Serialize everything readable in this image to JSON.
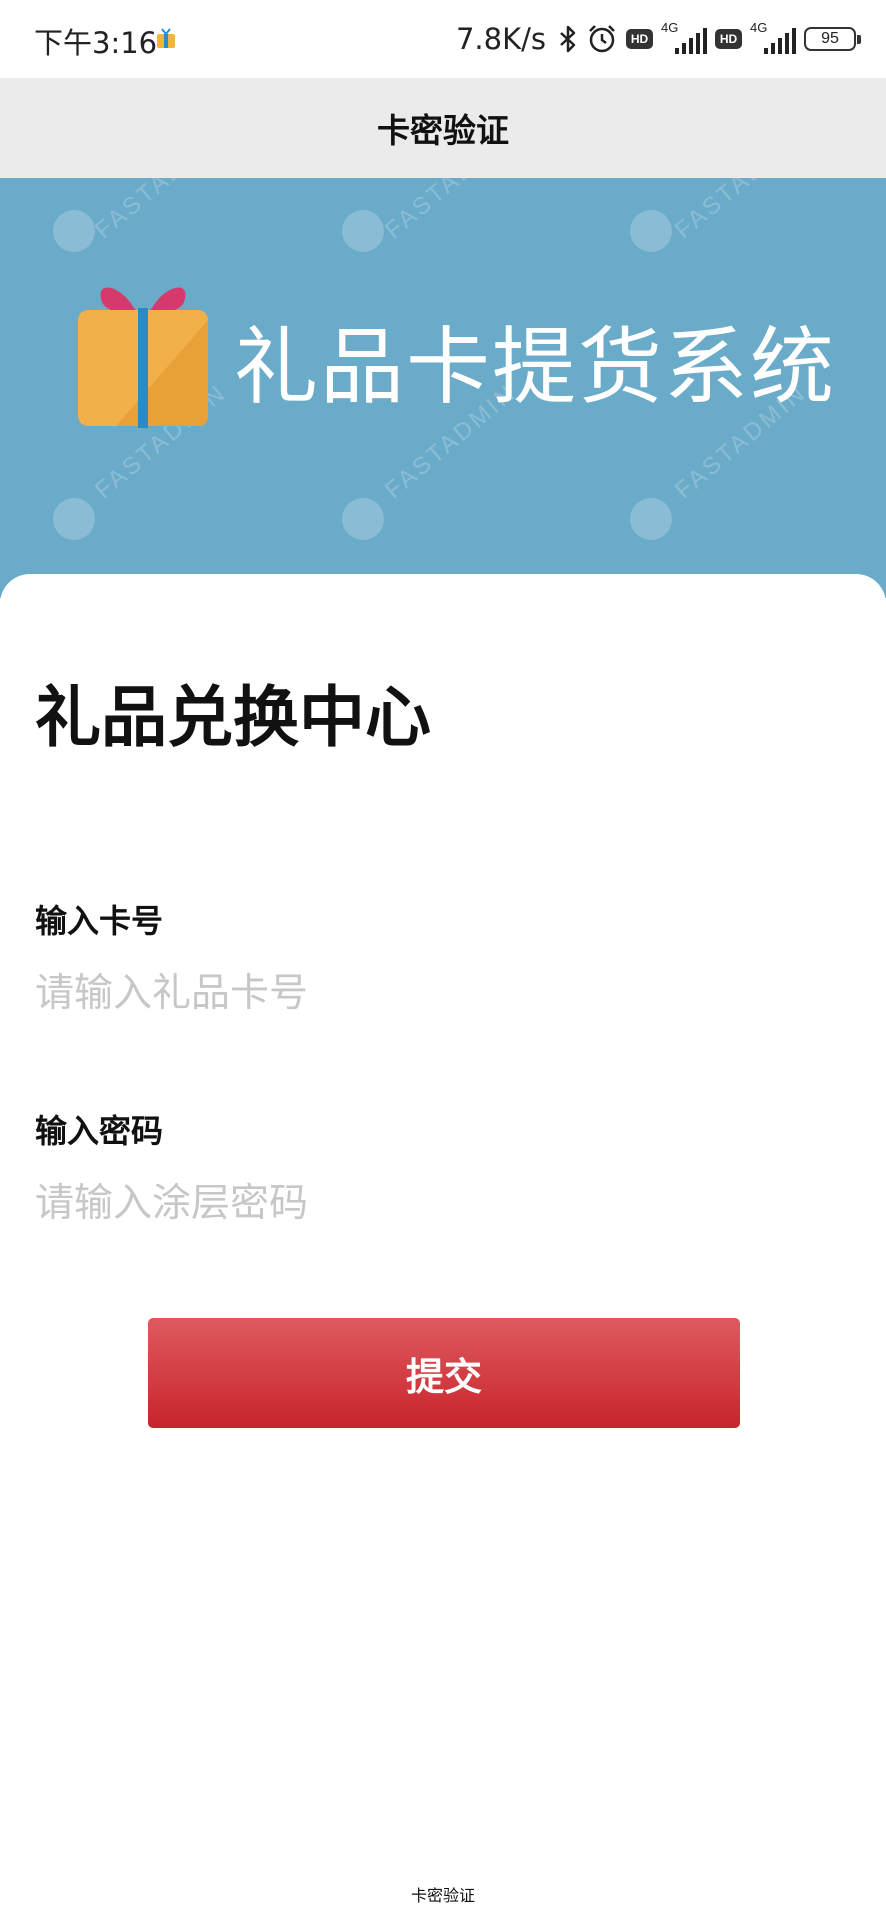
{
  "status_bar": {
    "time": "下午3:16",
    "net_speed": "7.8K/s",
    "hd_label": "HD",
    "network_type": "4G",
    "battery": "95",
    "icons": [
      "app-notification-icon",
      "bluetooth-icon",
      "alarm-icon",
      "signal-icon",
      "battery-icon"
    ]
  },
  "nav": {
    "title": "卡密验证"
  },
  "banner": {
    "title": "礼品卡提货系统",
    "watermark": "FASTADMIN",
    "background_color": "#6aabc9",
    "icon": "gift-box-icon"
  },
  "form": {
    "heading": "礼品兑换中心",
    "card_label": "输入卡号",
    "card_placeholder": "请输入礼品卡号",
    "card_value": "",
    "password_label": "输入密码",
    "password_placeholder": "请输入涂层密码",
    "password_value": "",
    "submit_label": "提交",
    "submit_color": "#c8242b"
  },
  "footer": {
    "text": "卡密验证"
  }
}
